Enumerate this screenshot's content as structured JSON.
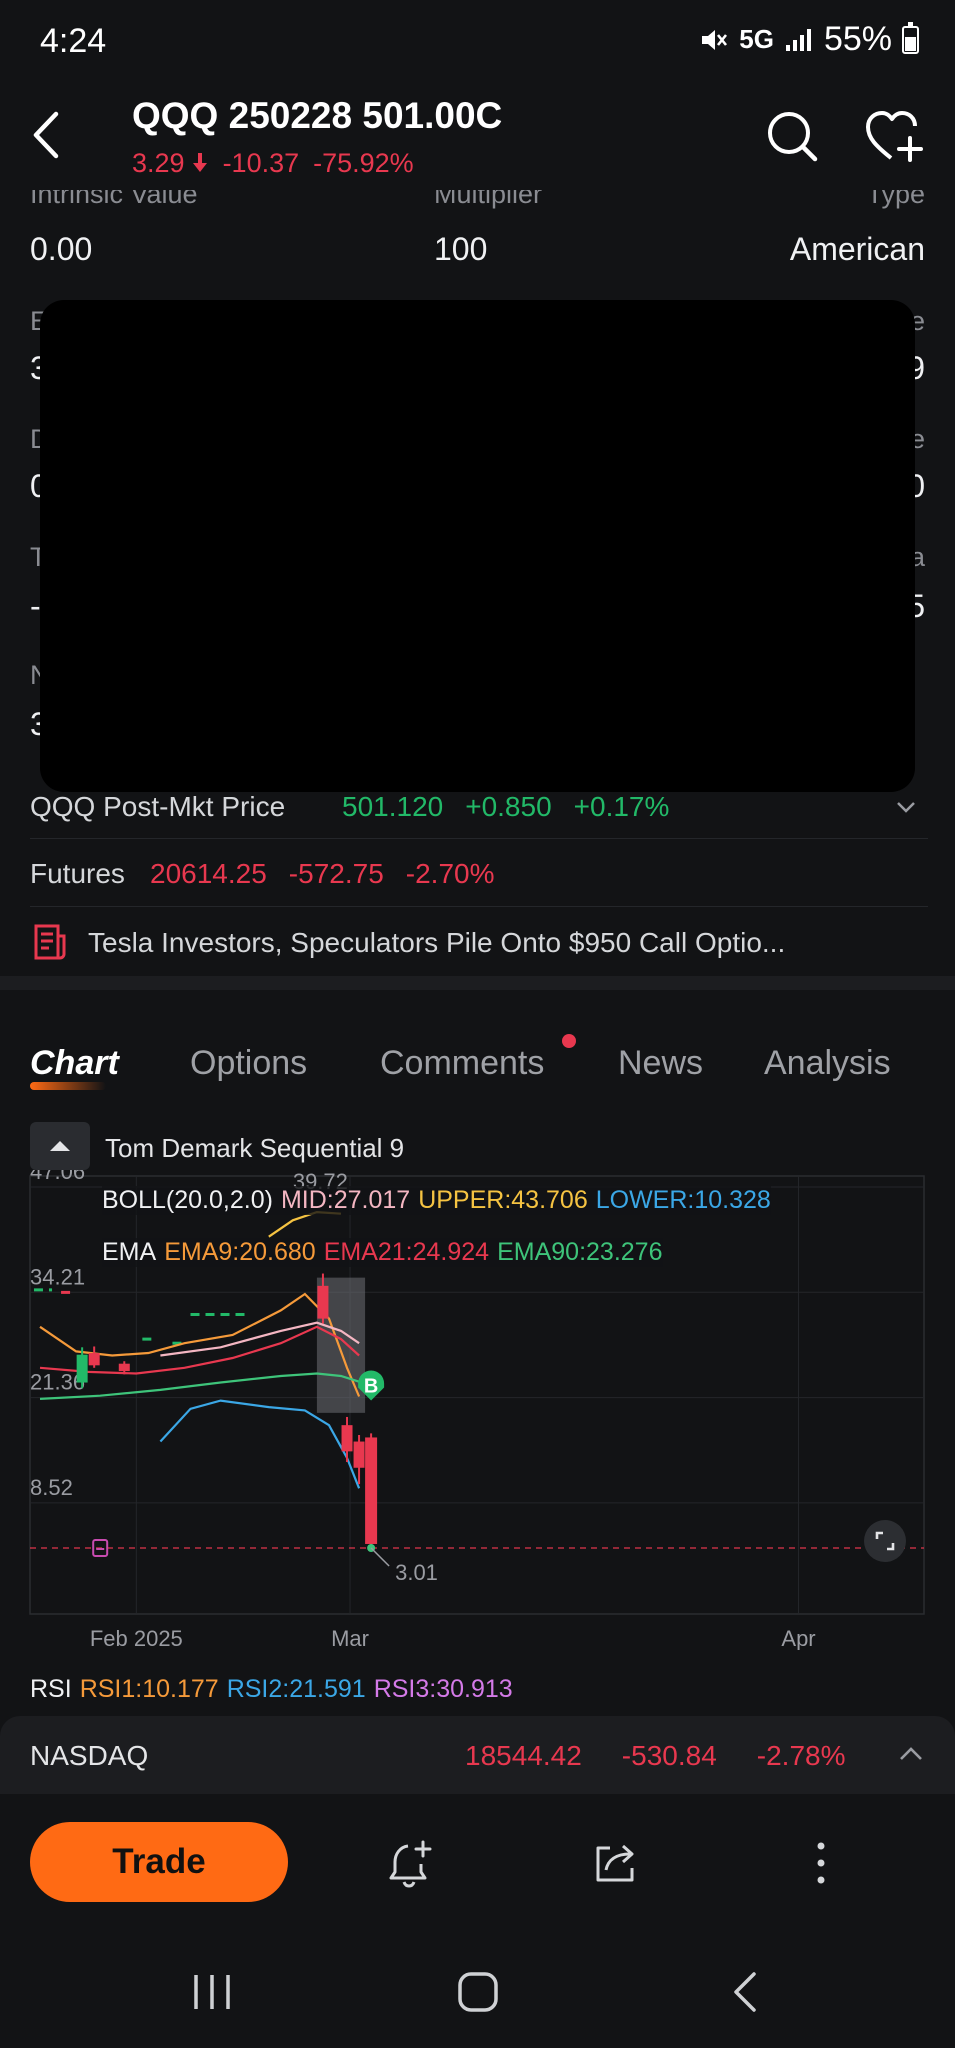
{
  "status": {
    "time": "4:24",
    "network": "5G",
    "battery": "55%"
  },
  "header": {
    "title": "QQQ 250228 501.00C",
    "price": "3.29",
    "change": "-10.37",
    "change_pct": "-75.92%"
  },
  "info_grid": {
    "row1": [
      {
        "label": "Intrinsic Value",
        "value": "0.00"
      },
      {
        "label": "Multiplier",
        "value": "100"
      },
      {
        "label": "Type",
        "value": "American"
      }
    ],
    "partial_left": [
      "E",
      "D",
      "T",
      "N"
    ],
    "partial_left_values": [
      "3",
      "0",
      "-",
      "3"
    ],
    "partial_right_labels": [
      "e",
      "e",
      "a"
    ],
    "partial_right_values": [
      "9",
      "0",
      "5"
    ]
  },
  "post_market": {
    "label": "QQQ Post-Mkt Price",
    "price": "501.120",
    "change": "+0.850",
    "change_pct": "+0.17%"
  },
  "futures": {
    "label": "Futures",
    "price": "20614.25",
    "change": "-572.75",
    "change_pct": "-2.70%"
  },
  "news": {
    "headline": "Tesla Investors, Speculators Pile Onto $950 Call Optio..."
  },
  "tabs": [
    {
      "label": "Chart"
    },
    {
      "label": "Options"
    },
    {
      "label": "Comments"
    },
    {
      "label": "News"
    },
    {
      "label": "Analysis"
    }
  ],
  "indicator": {
    "name": "Tom Demark Sequential 9"
  },
  "legend": {
    "boll": {
      "name": "BOLL(20.0,2.0)",
      "mid": "MID:27.017",
      "upper": "UPPER:43.706",
      "lower": "LOWER:10.328"
    },
    "ema": {
      "name": "EMA",
      "ema9": "EMA9:20.680",
      "ema21": "EMA21:24.924",
      "ema90": "EMA90:23.276"
    },
    "rsi": {
      "name": "RSI",
      "rsi1": "RSI1:10.177",
      "rsi2": "RSI2:21.591",
      "rsi3": "RSI3:30.913"
    }
  },
  "chart_data": {
    "type": "line",
    "y_ticks": [
      "47.06",
      "34.21",
      "21.36",
      "8.52"
    ],
    "x_ticks": [
      "Feb 2025",
      "Mar",
      "Apr"
    ],
    "ylim": [
      3.01,
      47.06
    ],
    "high_label": "39.72",
    "low_label": "3.01",
    "signal_marker": "B",
    "series": [
      {
        "name": "EMA9",
        "color": "#f59a3a",
        "values": [
          [
            0,
            30
          ],
          [
            6,
            27
          ],
          [
            12,
            26.5
          ],
          [
            18,
            26.8
          ],
          [
            24,
            28
          ],
          [
            32,
            29
          ],
          [
            40,
            32
          ],
          [
            44,
            34
          ],
          [
            48,
            31
          ],
          [
            51,
            25
          ],
          [
            53,
            21.5
          ]
        ]
      },
      {
        "name": "EMA21",
        "color": "#e8384f",
        "values": [
          [
            0,
            25
          ],
          [
            8,
            24.5
          ],
          [
            16,
            24.3
          ],
          [
            24,
            25
          ],
          [
            32,
            26.2
          ],
          [
            40,
            28
          ],
          [
            46,
            30
          ],
          [
            50,
            28.5
          ],
          [
            53,
            26.5
          ]
        ]
      },
      {
        "name": "EMA90",
        "color": "#3ec47a",
        "values": [
          [
            0,
            21.2
          ],
          [
            10,
            21.6
          ],
          [
            20,
            22.3
          ],
          [
            30,
            23.2
          ],
          [
            40,
            24
          ],
          [
            46,
            24.3
          ],
          [
            50,
            24
          ],
          [
            53,
            23.3
          ]
        ]
      },
      {
        "name": "MID",
        "color": "#f4b6c2",
        "values": [
          [
            20,
            26.5
          ],
          [
            30,
            27.5
          ],
          [
            40,
            29.5
          ],
          [
            46,
            30.5
          ],
          [
            50,
            29.5
          ],
          [
            53,
            28
          ]
        ]
      },
      {
        "name": "LOWER",
        "color": "#3ba7e6",
        "values": [
          [
            20,
            16
          ],
          [
            25,
            20
          ],
          [
            30,
            21
          ],
          [
            38,
            20.2
          ],
          [
            44,
            19.8
          ],
          [
            48,
            18
          ],
          [
            51,
            14
          ],
          [
            53,
            10.3
          ]
        ]
      },
      {
        "name": "UPPER",
        "color": "#f5c342",
        "values": [
          [
            38,
            41
          ],
          [
            42,
            43
          ],
          [
            46,
            44
          ],
          [
            50,
            43.8
          ]
        ]
      }
    ],
    "candles": [
      {
        "t": 7,
        "o": 26.6,
        "c": 23.2,
        "h": 27.5,
        "l": 22.5,
        "dir": "up"
      },
      {
        "t": 9,
        "o": 26.8,
        "c": 25.3,
        "h": 27.6,
        "l": 25,
        "dir": "down"
      },
      {
        "t": 14,
        "o": 25.5,
        "c": 24.6,
        "h": 25.8,
        "l": 24.2,
        "dir": "down"
      },
      {
        "t": 47,
        "o": 35,
        "c": 31,
        "h": 36.5,
        "l": 30.4,
        "dir": "down"
      },
      {
        "t": 51,
        "o": 18,
        "c": 14.8,
        "h": 19,
        "l": 13.5,
        "dir": "down"
      },
      {
        "t": 53,
        "o": 16,
        "c": 12.8,
        "h": 16.8,
        "l": 10.8,
        "dir": "down"
      },
      {
        "t": 55,
        "o": 16.5,
        "c": 3.5,
        "h": 17,
        "l": 3.01,
        "dir": "down"
      }
    ]
  },
  "nasdaq": {
    "name": "NASDAQ",
    "price": "18544.42",
    "change": "-530.84",
    "change_pct": "-2.78%"
  },
  "toolbar": {
    "trade_label": "Trade"
  },
  "colors": {
    "accent": "#ff6a14",
    "down": "#e8384f",
    "up": "#22b968",
    "background": "#121315"
  }
}
